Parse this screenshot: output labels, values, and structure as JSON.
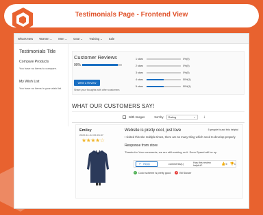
{
  "header": {
    "title": "Testimonials Page - Frontend View"
  },
  "nav": {
    "items": [
      "What's New",
      "Women",
      "Men",
      "Gear",
      "Training",
      "Sale"
    ]
  },
  "sidebar": {
    "title": "Testimonials Title",
    "compare_heading": "Compare Products",
    "compare_text": "You have no items to compare.",
    "wishlist_heading": "My Wish List",
    "wishlist_text": "You have no items in your wish list."
  },
  "customer_reviews": {
    "title": "Customer Reviews",
    "percent_label": "90%",
    "percent_value": 90,
    "write_button": "Write a Review",
    "share_text": "Share your thoughts with other customers",
    "star_rows": [
      {
        "label": "1 stars",
        "count": "0%(0)",
        "fraction": 0
      },
      {
        "label": "2 stars",
        "count": "0%(0)",
        "fraction": 0
      },
      {
        "label": "3 stars",
        "count": "0%(0)",
        "fraction": 0
      },
      {
        "label": "4 stars",
        "count": "50%(1)",
        "fraction": 0.5
      },
      {
        "label": "5 stars",
        "count": "50%(1)",
        "fraction": 0.5
      }
    ]
  },
  "section": {
    "title": "WHAT OUR CUSTOMERS SAY!"
  },
  "filters": {
    "with_images": "With Images",
    "sort_label": "Sort by",
    "sort_value": "Rating",
    "direction_arrow": "↓"
  },
  "review": {
    "name": "Emiley",
    "date": "2022-11-04 09:26:37",
    "stars": "★★★★☆",
    "rating": 4,
    "title": "Website is pretty cool, just love",
    "helpful": "5 people found this helpful",
    "body": "I visited this site multiple times, there are so many thing which need to develop properly",
    "response_heading": "Response from store",
    "response_text": "Thanks for Your comments, we are still working on it. Soon Speed will be up",
    "reply_label": "Reply",
    "comments_label": "comments(1)",
    "helpful_question": "Has this review helpful?",
    "thumbs_up_count": "5",
    "thumbs_down_count": "1",
    "pro_text": "Color scheme is pretty good",
    "con_text": "Bit Slower"
  },
  "colors": {
    "accent": "#e8622f",
    "primary": "#1a6fc2",
    "star": "#f0b428"
  }
}
